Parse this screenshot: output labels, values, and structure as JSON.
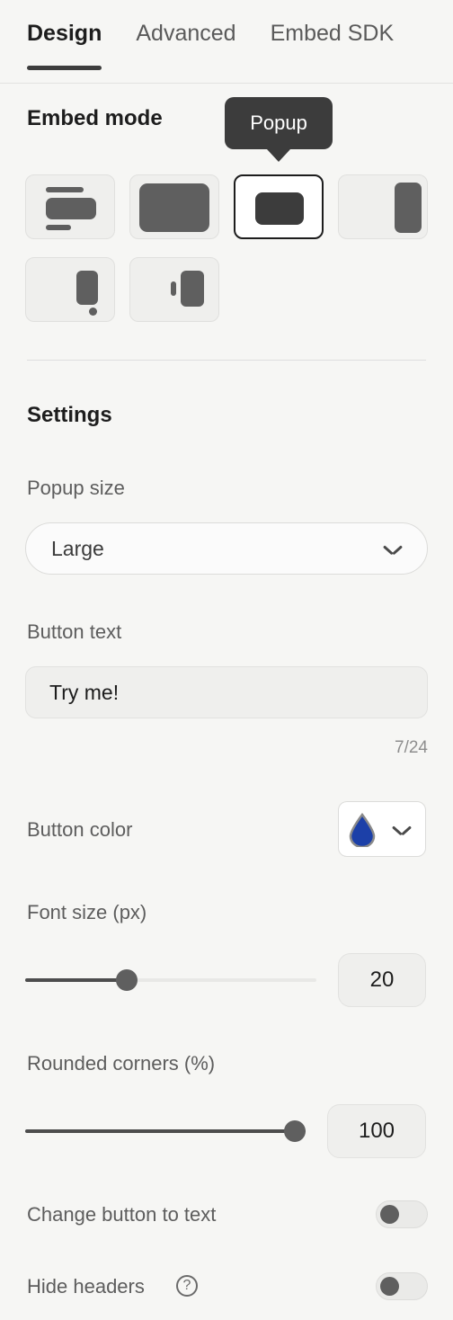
{
  "tabs": [
    {
      "label": "Design",
      "active": true
    },
    {
      "label": "Advanced",
      "active": false
    },
    {
      "label": "Embed SDK",
      "active": false
    }
  ],
  "embed_mode": {
    "title": "Embed mode",
    "tooltip": "Popup",
    "selected_index": 2,
    "options": [
      {
        "name": "inline"
      },
      {
        "name": "full-page"
      },
      {
        "name": "popup"
      },
      {
        "name": "side-panel"
      },
      {
        "name": "popover"
      },
      {
        "name": "side-tab"
      }
    ]
  },
  "settings": {
    "title": "Settings",
    "popup_size": {
      "label": "Popup size",
      "value": "Large",
      "icon": "chevron-down-icon"
    },
    "button_text": {
      "label": "Button text",
      "value": "Try me!",
      "counter": "7/24"
    },
    "button_color": {
      "label": "Button color",
      "color": "#1c40a8",
      "icon": "droplet-icon",
      "chevron": "chevron-down-icon"
    },
    "font_size": {
      "label": "Font size (px)",
      "value": "20",
      "percent": 35
    },
    "rounded_corners": {
      "label": "Rounded corners (%)",
      "value": "100",
      "percent": 100
    },
    "change_button_to_text": {
      "label": "Change button to text",
      "enabled": false
    },
    "hide_headers": {
      "label": "Hide headers",
      "enabled": false,
      "help_icon": "help-circle-icon",
      "help_glyph": "?"
    }
  },
  "colors": {
    "background": "#f6f6f4",
    "accent": "#3d3d3d",
    "tooltip_bg": "#3c3c3c",
    "droplet": "#1c40a8"
  }
}
